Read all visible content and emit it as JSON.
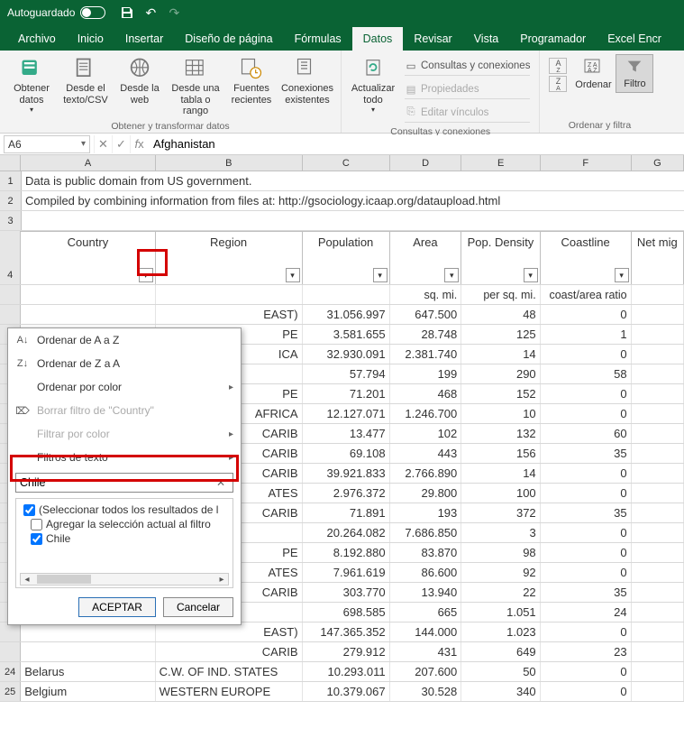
{
  "titlebar": {
    "autosave": "Autoguardado"
  },
  "tabs": [
    "Archivo",
    "Inicio",
    "Insertar",
    "Diseño de página",
    "Fórmulas",
    "Datos",
    "Revisar",
    "Vista",
    "Programador",
    "Excel Encr"
  ],
  "active_tab": 5,
  "ribbon": {
    "g1": {
      "label": "Obtener y transformar datos",
      "btns": [
        "Obtener datos",
        "Desde el texto/CSV",
        "Desde la web",
        "Desde una tabla o rango",
        "Fuentes recientes",
        "Conexiones existentes"
      ]
    },
    "g2": {
      "label": "Consultas y conexiones",
      "refresh": "Actualizar todo",
      "rows": [
        "Consultas y conexiones",
        "Propiedades",
        "Editar vínculos"
      ]
    },
    "g3": {
      "label": "Ordenar y filtra",
      "sort": "Ordenar",
      "filter": "Filtro"
    }
  },
  "namebox": "A6",
  "formula": "Afghanistan",
  "cols": [
    "A",
    "B",
    "C",
    "D",
    "E",
    "F",
    "G"
  ],
  "rows_info": {
    "r1": "Data is public domain from US government.",
    "r2": "Compiled by combining information from files at: http://gsociology.icaap.org/dataupload.html"
  },
  "headers": [
    "Country",
    "Region",
    "Population",
    "Area",
    "Pop. Density",
    "Coastline",
    "Net mig"
  ],
  "units": [
    "",
    "",
    "",
    "sq. mi.",
    "per sq. mi.",
    "coast/area ratio",
    ""
  ],
  "data_rows": [
    {
      "n": "",
      "region": "EAST)",
      "pop": "31.056.997",
      "area": "647.500",
      "dens": "48",
      "coast": "0"
    },
    {
      "n": "",
      "region": "PE",
      "pop": "3.581.655",
      "area": "28.748",
      "dens": "125",
      "coast": "1"
    },
    {
      "n": "",
      "region": "ICA",
      "pop": "32.930.091",
      "area": "2.381.740",
      "dens": "14",
      "coast": "0"
    },
    {
      "n": "",
      "region": "",
      "pop": "57.794",
      "area": "199",
      "dens": "290",
      "coast": "58"
    },
    {
      "n": "",
      "region": "PE",
      "pop": "71.201",
      "area": "468",
      "dens": "152",
      "coast": "0"
    },
    {
      "n": "",
      "region": "AFRICA",
      "pop": "12.127.071",
      "area": "1.246.700",
      "dens": "10",
      "coast": "0"
    },
    {
      "n": "",
      "region": "CARIB",
      "pop": "13.477",
      "area": "102",
      "dens": "132",
      "coast": "60"
    },
    {
      "n": "",
      "region": "CARIB",
      "pop": "69.108",
      "area": "443",
      "dens": "156",
      "coast": "35"
    },
    {
      "n": "",
      "region": "CARIB",
      "pop": "39.921.833",
      "area": "2.766.890",
      "dens": "14",
      "coast": "0"
    },
    {
      "n": "",
      "region": "ATES",
      "pop": "2.976.372",
      "area": "29.800",
      "dens": "100",
      "coast": "0"
    },
    {
      "n": "",
      "region": "CARIB",
      "pop": "71.891",
      "area": "193",
      "dens": "372",
      "coast": "35"
    },
    {
      "n": "",
      "region": "",
      "pop": "20.264.082",
      "area": "7.686.850",
      "dens": "3",
      "coast": "0"
    },
    {
      "n": "",
      "region": "PE",
      "pop": "8.192.880",
      "area": "83.870",
      "dens": "98",
      "coast": "0"
    },
    {
      "n": "",
      "region": "ATES",
      "pop": "7.961.619",
      "area": "86.600",
      "dens": "92",
      "coast": "0"
    },
    {
      "n": "",
      "region": "CARIB",
      "pop": "303.770",
      "area": "13.940",
      "dens": "22",
      "coast": "35"
    },
    {
      "n": "",
      "region": "",
      "pop": "698.585",
      "area": "665",
      "dens": "1.051",
      "coast": "24"
    },
    {
      "n": "",
      "region": "EAST)",
      "pop": "147.365.352",
      "area": "144.000",
      "dens": "1.023",
      "coast": "0"
    },
    {
      "n": "",
      "region": "CARIB",
      "pop": "279.912",
      "area": "431",
      "dens": "649",
      "coast": "23"
    }
  ],
  "bottom_rows": [
    {
      "rn": "24",
      "country": "Belarus",
      "region": "C.W. OF IND. STATES",
      "pop": "10.293.011",
      "area": "207.600",
      "dens": "50",
      "coast": "0"
    },
    {
      "rn": "25",
      "country": "Belgium",
      "region": "WESTERN EUROPE",
      "pop": "10.379.067",
      "area": "30.528",
      "dens": "340",
      "coast": "0"
    }
  ],
  "popup": {
    "sort_az": "Ordenar de A a Z",
    "sort_za": "Ordenar de Z a A",
    "sort_color": "Ordenar por color",
    "clear": "Borrar filtro de \"Country\"",
    "filter_color": "Filtrar por color",
    "text_filters": "Filtros de texto",
    "search_value": "Chile",
    "opt_select_all": "(Seleccionar todos los resultados de l",
    "opt_add": "Agregar la selección actual al filtro",
    "opt_chile": "Chile",
    "accept": "ACEPTAR",
    "cancel": "Cancelar"
  }
}
